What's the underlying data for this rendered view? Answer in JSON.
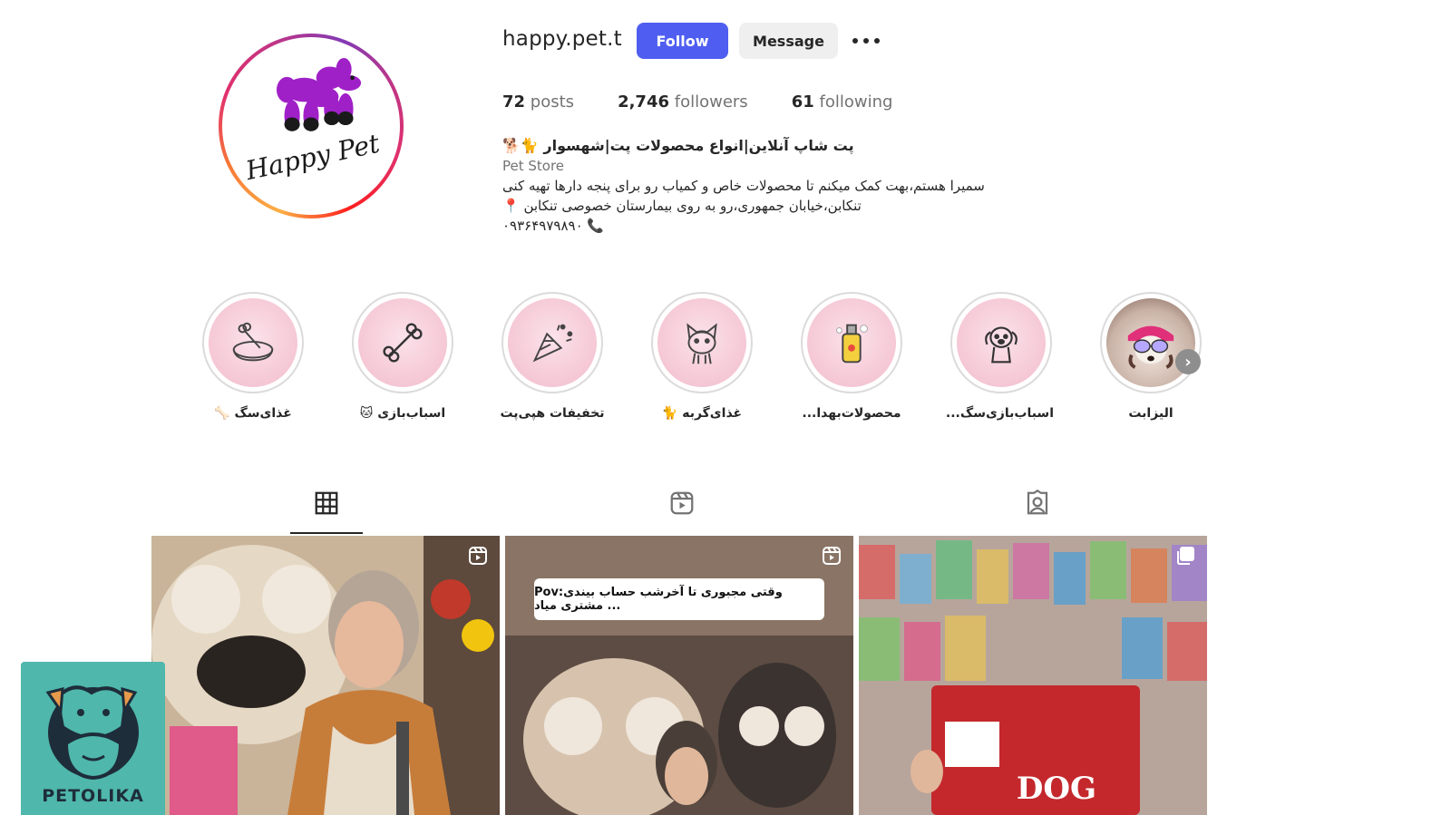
{
  "profile": {
    "username": "happy.pet.t",
    "follow_label": "Follow",
    "message_label": "Message",
    "avatar_text": "Happy Pet"
  },
  "stats": [
    {
      "count": "72",
      "label": "posts"
    },
    {
      "count": "2,746",
      "label": "followers"
    },
    {
      "count": "61",
      "label": "following"
    }
  ],
  "bio": {
    "name": "پت شاپ آنلاین|انواع محصولات پت|شهسوار 🐈🐕",
    "category": "Pet Store",
    "line1": "سمیرا هستم،بهت کمک میکنم تا محصولات خاص و کمیاب رو برای پنجه دارها تهیه کنی",
    "line2": "تنکابن،خیابان جمهوری،رو به روی بیمارستان خصوصی تنکابن 📍",
    "line3": "۰۹۳۶۴۹۷۹۸۹۰ 📞"
  },
  "highlights": [
    {
      "label": "غذای‌سگ 🦴",
      "icon": "dog-bowl-icon"
    },
    {
      "label": "اسباب‌بازی 🐱",
      "icon": "bone-icon"
    },
    {
      "label": "تخفیفات هپی‌پت",
      "icon": "party-popper-icon"
    },
    {
      "label": "غذای‌گربه 🐈",
      "icon": "cat-icon"
    },
    {
      "label": "محصولات‌بهدا...",
      "icon": "shampoo-bottle-icon"
    },
    {
      "label": "اسباب‌بازی‌سگ...",
      "icon": "puppy-icon"
    },
    {
      "label": "الیزابت",
      "icon": "dog-with-sunglasses-photo"
    }
  ],
  "tabs": [
    {
      "name": "posts",
      "icon": "grid-icon"
    },
    {
      "name": "reels",
      "icon": "reels-icon"
    },
    {
      "name": "tagged",
      "icon": "tagged-user-icon"
    }
  ],
  "posts": [
    {
      "type": "reel",
      "caption": ""
    },
    {
      "type": "reel",
      "caption": "Pov:وقتی مجبوری تا آخرشب حساب بیندی مشتری میاد ..."
    },
    {
      "type": "carousel",
      "caption": ""
    }
  ],
  "watermark": {
    "text": "PETOLIKA"
  },
  "colors": {
    "follow_button": "#4f5ef1",
    "message_button": "#efefef",
    "highlight_bg": "#f5c7d5",
    "watermark_bg": "#4fb7ac"
  }
}
